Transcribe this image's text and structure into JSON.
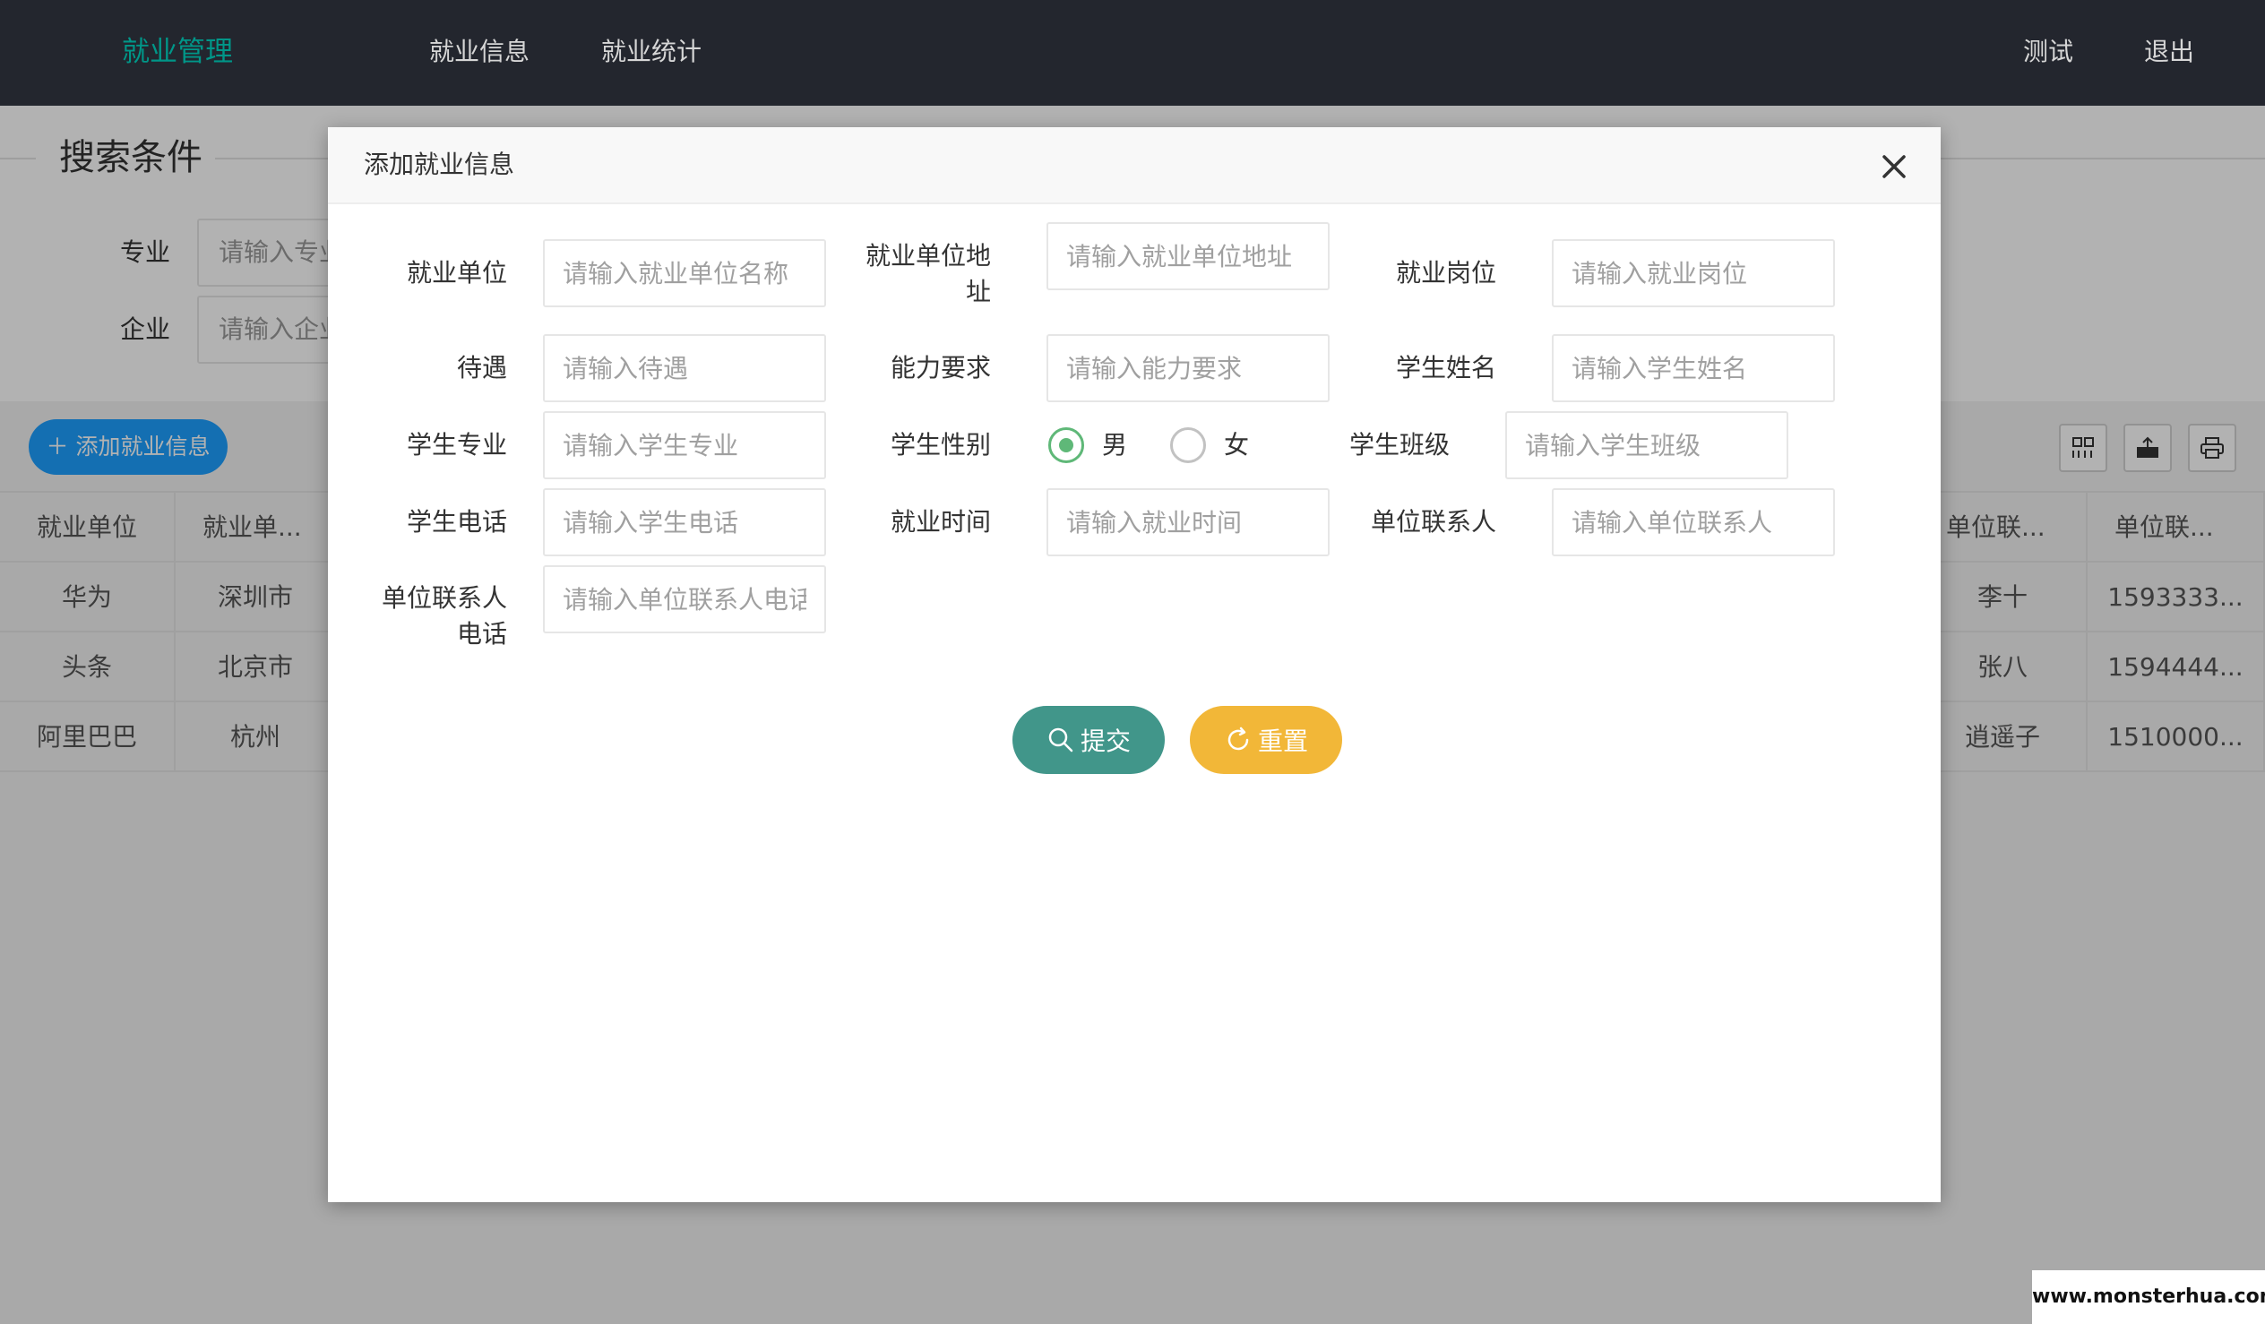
{
  "nav": {
    "brand": "就业管理",
    "items": [
      "就业信息",
      "就业统计"
    ],
    "user": "测试",
    "logout": "退出"
  },
  "search": {
    "title": "搜索条件",
    "major_label": "专业",
    "major_placeholder": "请输入专业",
    "company_label": "企业",
    "company_placeholder": "请输入企业"
  },
  "toolbar": {
    "add_label": "添加就业信息",
    "icons": [
      "grid-icon",
      "export-icon",
      "print-icon"
    ]
  },
  "table": {
    "left_headers": [
      "就业单位",
      "就业单..."
    ],
    "right_headers": [
      "单位联...",
      "单位联..."
    ],
    "rows": [
      {
        "company": "华为",
        "address": "深圳市",
        "contact": "李十",
        "phone": "1593333..."
      },
      {
        "company": "头条",
        "address": "北京市",
        "contact": "张八",
        "phone": "1594444..."
      },
      {
        "company": "阿里巴巴",
        "address": "杭州",
        "contact": "逍遥子",
        "phone": "1510000..."
      }
    ]
  },
  "modal": {
    "title": "添加就业信息",
    "fields": {
      "company": {
        "label": "就业单位",
        "placeholder": "请输入就业单位名称"
      },
      "address": {
        "label_line1": "就业单位地",
        "label_line2": "址",
        "placeholder": "请输入就业单位地址"
      },
      "position": {
        "label": "就业岗位",
        "placeholder": "请输入就业岗位"
      },
      "salary": {
        "label": "待遇",
        "placeholder": "请输入待遇"
      },
      "ability": {
        "label": "能力要求",
        "placeholder": "请输入能力要求"
      },
      "student_name": {
        "label": "学生姓名",
        "placeholder": "请输入学生姓名"
      },
      "student_major": {
        "label": "学生专业",
        "placeholder": "请输入学生专业"
      },
      "gender": {
        "label": "学生性别",
        "options": [
          "男",
          "女"
        ],
        "selected": "男"
      },
      "student_class": {
        "label": "学生班级",
        "placeholder": "请输入学生班级"
      },
      "student_phone": {
        "label": "学生电话",
        "placeholder": "请输入学生电话"
      },
      "employ_time": {
        "label": "就业时间",
        "placeholder": "请输入就业时间"
      },
      "contact": {
        "label": "单位联系人",
        "placeholder": "请输入单位联系人"
      },
      "contact_phone": {
        "label_line1": "单位联系人",
        "label_line2": "电话",
        "placeholder": "请输入单位联系人电话"
      }
    },
    "submit_label": "提交",
    "reset_label": "重置"
  },
  "watermark": "www.monsterhua.com",
  "colors": {
    "topbar": "#23262e",
    "brand": "#009688",
    "primary_button": "#1e9fff",
    "submit": "#41968a",
    "reset": "#f2b738",
    "radio_checked": "#5fb878"
  }
}
